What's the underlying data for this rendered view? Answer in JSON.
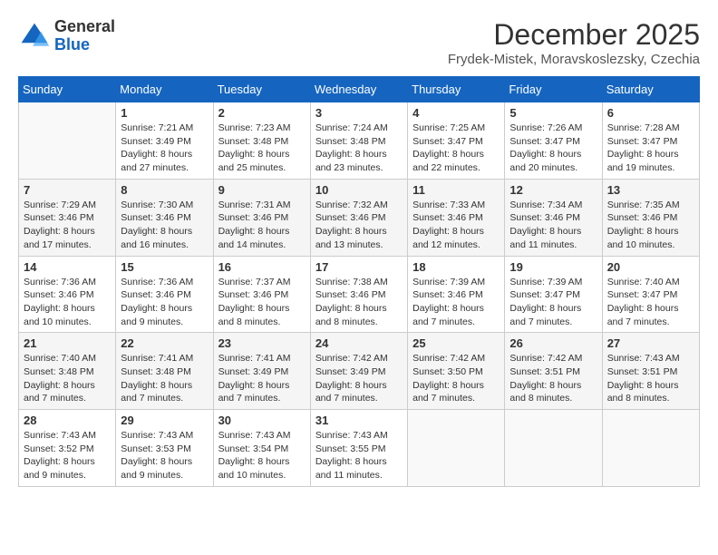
{
  "header": {
    "logo_general": "General",
    "logo_blue": "Blue",
    "month_year": "December 2025",
    "location": "Frydek-Mistek, Moravskoslezsky, Czechia"
  },
  "weekdays": [
    "Sunday",
    "Monday",
    "Tuesday",
    "Wednesday",
    "Thursday",
    "Friday",
    "Saturday"
  ],
  "weeks": [
    [
      {
        "day": "",
        "sunrise": "",
        "sunset": "",
        "daylight": ""
      },
      {
        "day": "1",
        "sunrise": "Sunrise: 7:21 AM",
        "sunset": "Sunset: 3:49 PM",
        "daylight": "Daylight: 8 hours and 27 minutes."
      },
      {
        "day": "2",
        "sunrise": "Sunrise: 7:23 AM",
        "sunset": "Sunset: 3:48 PM",
        "daylight": "Daylight: 8 hours and 25 minutes."
      },
      {
        "day": "3",
        "sunrise": "Sunrise: 7:24 AM",
        "sunset": "Sunset: 3:48 PM",
        "daylight": "Daylight: 8 hours and 23 minutes."
      },
      {
        "day": "4",
        "sunrise": "Sunrise: 7:25 AM",
        "sunset": "Sunset: 3:47 PM",
        "daylight": "Daylight: 8 hours and 22 minutes."
      },
      {
        "day": "5",
        "sunrise": "Sunrise: 7:26 AM",
        "sunset": "Sunset: 3:47 PM",
        "daylight": "Daylight: 8 hours and 20 minutes."
      },
      {
        "day": "6",
        "sunrise": "Sunrise: 7:28 AM",
        "sunset": "Sunset: 3:47 PM",
        "daylight": "Daylight: 8 hours and 19 minutes."
      }
    ],
    [
      {
        "day": "7",
        "sunrise": "Sunrise: 7:29 AM",
        "sunset": "Sunset: 3:46 PM",
        "daylight": "Daylight: 8 hours and 17 minutes."
      },
      {
        "day": "8",
        "sunrise": "Sunrise: 7:30 AM",
        "sunset": "Sunset: 3:46 PM",
        "daylight": "Daylight: 8 hours and 16 minutes."
      },
      {
        "day": "9",
        "sunrise": "Sunrise: 7:31 AM",
        "sunset": "Sunset: 3:46 PM",
        "daylight": "Daylight: 8 hours and 14 minutes."
      },
      {
        "day": "10",
        "sunrise": "Sunrise: 7:32 AM",
        "sunset": "Sunset: 3:46 PM",
        "daylight": "Daylight: 8 hours and 13 minutes."
      },
      {
        "day": "11",
        "sunrise": "Sunrise: 7:33 AM",
        "sunset": "Sunset: 3:46 PM",
        "daylight": "Daylight: 8 hours and 12 minutes."
      },
      {
        "day": "12",
        "sunrise": "Sunrise: 7:34 AM",
        "sunset": "Sunset: 3:46 PM",
        "daylight": "Daylight: 8 hours and 11 minutes."
      },
      {
        "day": "13",
        "sunrise": "Sunrise: 7:35 AM",
        "sunset": "Sunset: 3:46 PM",
        "daylight": "Daylight: 8 hours and 10 minutes."
      }
    ],
    [
      {
        "day": "14",
        "sunrise": "Sunrise: 7:36 AM",
        "sunset": "Sunset: 3:46 PM",
        "daylight": "Daylight: 8 hours and 10 minutes."
      },
      {
        "day": "15",
        "sunrise": "Sunrise: 7:36 AM",
        "sunset": "Sunset: 3:46 PM",
        "daylight": "Daylight: 8 hours and 9 minutes."
      },
      {
        "day": "16",
        "sunrise": "Sunrise: 7:37 AM",
        "sunset": "Sunset: 3:46 PM",
        "daylight": "Daylight: 8 hours and 8 minutes."
      },
      {
        "day": "17",
        "sunrise": "Sunrise: 7:38 AM",
        "sunset": "Sunset: 3:46 PM",
        "daylight": "Daylight: 8 hours and 8 minutes."
      },
      {
        "day": "18",
        "sunrise": "Sunrise: 7:39 AM",
        "sunset": "Sunset: 3:46 PM",
        "daylight": "Daylight: 8 hours and 7 minutes."
      },
      {
        "day": "19",
        "sunrise": "Sunrise: 7:39 AM",
        "sunset": "Sunset: 3:47 PM",
        "daylight": "Daylight: 8 hours and 7 minutes."
      },
      {
        "day": "20",
        "sunrise": "Sunrise: 7:40 AM",
        "sunset": "Sunset: 3:47 PM",
        "daylight": "Daylight: 8 hours and 7 minutes."
      }
    ],
    [
      {
        "day": "21",
        "sunrise": "Sunrise: 7:40 AM",
        "sunset": "Sunset: 3:48 PM",
        "daylight": "Daylight: 8 hours and 7 minutes."
      },
      {
        "day": "22",
        "sunrise": "Sunrise: 7:41 AM",
        "sunset": "Sunset: 3:48 PM",
        "daylight": "Daylight: 8 hours and 7 minutes."
      },
      {
        "day": "23",
        "sunrise": "Sunrise: 7:41 AM",
        "sunset": "Sunset: 3:49 PM",
        "daylight": "Daylight: 8 hours and 7 minutes."
      },
      {
        "day": "24",
        "sunrise": "Sunrise: 7:42 AM",
        "sunset": "Sunset: 3:49 PM",
        "daylight": "Daylight: 8 hours and 7 minutes."
      },
      {
        "day": "25",
        "sunrise": "Sunrise: 7:42 AM",
        "sunset": "Sunset: 3:50 PM",
        "daylight": "Daylight: 8 hours and 7 minutes."
      },
      {
        "day": "26",
        "sunrise": "Sunrise: 7:42 AM",
        "sunset": "Sunset: 3:51 PM",
        "daylight": "Daylight: 8 hours and 8 minutes."
      },
      {
        "day": "27",
        "sunrise": "Sunrise: 7:43 AM",
        "sunset": "Sunset: 3:51 PM",
        "daylight": "Daylight: 8 hours and 8 minutes."
      }
    ],
    [
      {
        "day": "28",
        "sunrise": "Sunrise: 7:43 AM",
        "sunset": "Sunset: 3:52 PM",
        "daylight": "Daylight: 8 hours and 9 minutes."
      },
      {
        "day": "29",
        "sunrise": "Sunrise: 7:43 AM",
        "sunset": "Sunset: 3:53 PM",
        "daylight": "Daylight: 8 hours and 9 minutes."
      },
      {
        "day": "30",
        "sunrise": "Sunrise: 7:43 AM",
        "sunset": "Sunset: 3:54 PM",
        "daylight": "Daylight: 8 hours and 10 minutes."
      },
      {
        "day": "31",
        "sunrise": "Sunrise: 7:43 AM",
        "sunset": "Sunset: 3:55 PM",
        "daylight": "Daylight: 8 hours and 11 minutes."
      },
      {
        "day": "",
        "sunrise": "",
        "sunset": "",
        "daylight": ""
      },
      {
        "day": "",
        "sunrise": "",
        "sunset": "",
        "daylight": ""
      },
      {
        "day": "",
        "sunrise": "",
        "sunset": "",
        "daylight": ""
      }
    ]
  ]
}
